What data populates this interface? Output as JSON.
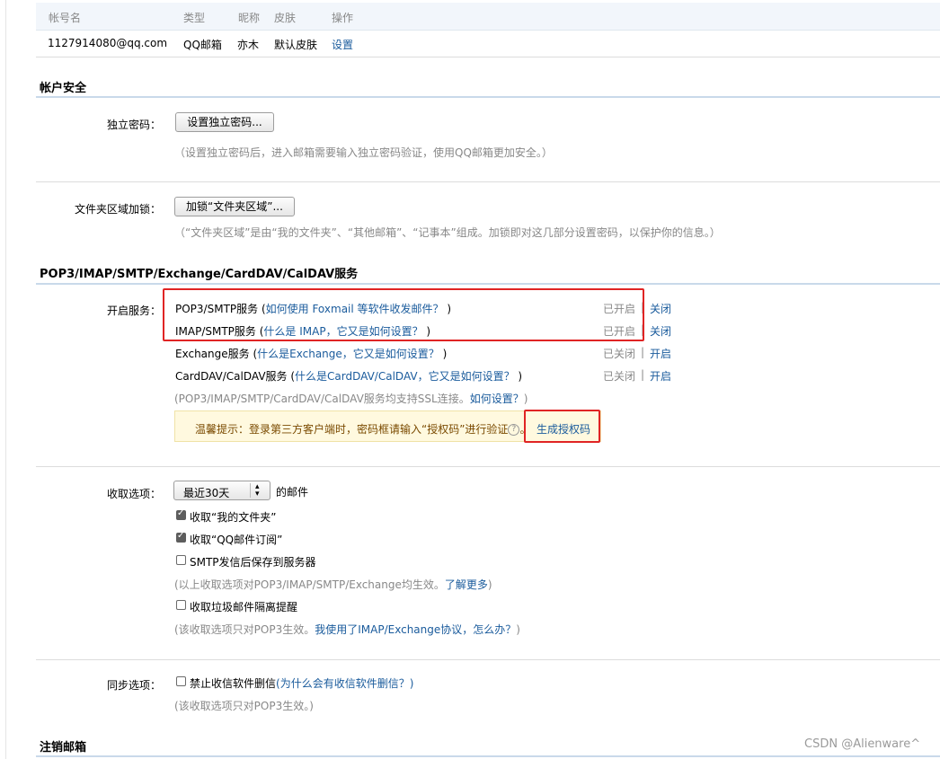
{
  "account_table": {
    "headers": [
      "帐号名",
      "类型",
      "昵称",
      "皮肤",
      "操作"
    ],
    "row": {
      "email": "1127914080@qq.com",
      "type": "QQ邮箱",
      "nickname": "亦木",
      "skin": "默认皮肤",
      "action": "设置"
    }
  },
  "security": {
    "title": "帐户安全",
    "independent_password": {
      "label": "独立密码：",
      "button": "设置独立密码...",
      "hint": "（设置独立密码后，进入邮箱需要输入独立密码验证，使用QQ邮箱更加安全。）"
    },
    "folder_lock": {
      "label": "文件夹区域加锁：",
      "button": "加锁“文件夹区域”...",
      "hint": "（“文件夹区域”是由“我的文件夹”、“其他邮箱”、“记事本”组成。加锁即对这几部分设置密码，以保护你的信息。）"
    }
  },
  "services": {
    "title": "POP3/IMAP/SMTP/Exchange/CardDAV/CalDAV服务",
    "label": "开启服务：",
    "items": [
      {
        "name": "POP3/SMTP服务",
        "paren_open": " (",
        "help": "如何使用 Foxmail 等软件收发邮件？",
        "paren_close": " )",
        "status": "已开启",
        "sep": "|",
        "action": "关闭"
      },
      {
        "name": "IMAP/SMTP服务",
        "paren_open": " (",
        "help": "什么是 IMAP，它又是如何设置？",
        "paren_close": " )",
        "status": "已开启",
        "sep": "|",
        "action": "关闭"
      },
      {
        "name": "Exchange服务",
        "paren_open": " (",
        "help": "什么是Exchange，它又是如何设置？",
        "paren_close": " )",
        "status": "已关闭",
        "sep": "|",
        "action": "开启"
      },
      {
        "name": "CardDAV/CalDAV服务",
        "paren_open": " (",
        "help": "什么是CardDAV/CalDAV，它又是如何设置？",
        "paren_close": " )",
        "status": "已关闭",
        "sep": "|",
        "action": "开启"
      }
    ],
    "ssl_note": "(POP3/IMAP/SMTP/CardDAV/CalDAV服务均支持SSL连接。",
    "ssl_link": "如何设置？",
    "ssl_close": ")",
    "tip_text": "温馨提示：登录第三方客户端时，密码框请输入“授权码”进行验证",
    "tip_icon": "?",
    "tip_dot": "。",
    "tip_link": "生成授权码"
  },
  "receive": {
    "label": "收取选项：",
    "select_value": "最近30天",
    "suffix": "的邮件",
    "options": [
      {
        "text": "收取“我的文件夹”",
        "checked": true
      },
      {
        "text": "收取“QQ邮件订阅”",
        "checked": true
      },
      {
        "text": "SMTP发信后保存到服务器",
        "checked": false
      }
    ],
    "note1": "(以上收取选项对POP3/IMAP/SMTP/Exchange均生效。",
    "note1_link": "了解更多",
    "note1_close": ")",
    "spam_option": {
      "text": "收取垃圾邮件隔离提醒",
      "checked": false
    },
    "note2": "(该收取选项只对POP3生效。",
    "note2_link": "我使用了IMAP/Exchange协议，怎么办？",
    "note2_close": ")"
  },
  "sync": {
    "label": "同步选项：",
    "option": {
      "text": "禁止收信软件删信",
      "checked": false
    },
    "option_link": "(为什么会有收信软件删信？)",
    "note": "(该收取选项只对POP3生效。)"
  },
  "cancel_account": {
    "title": "注销邮箱"
  },
  "watermark": "CSDN @Alienware^"
}
